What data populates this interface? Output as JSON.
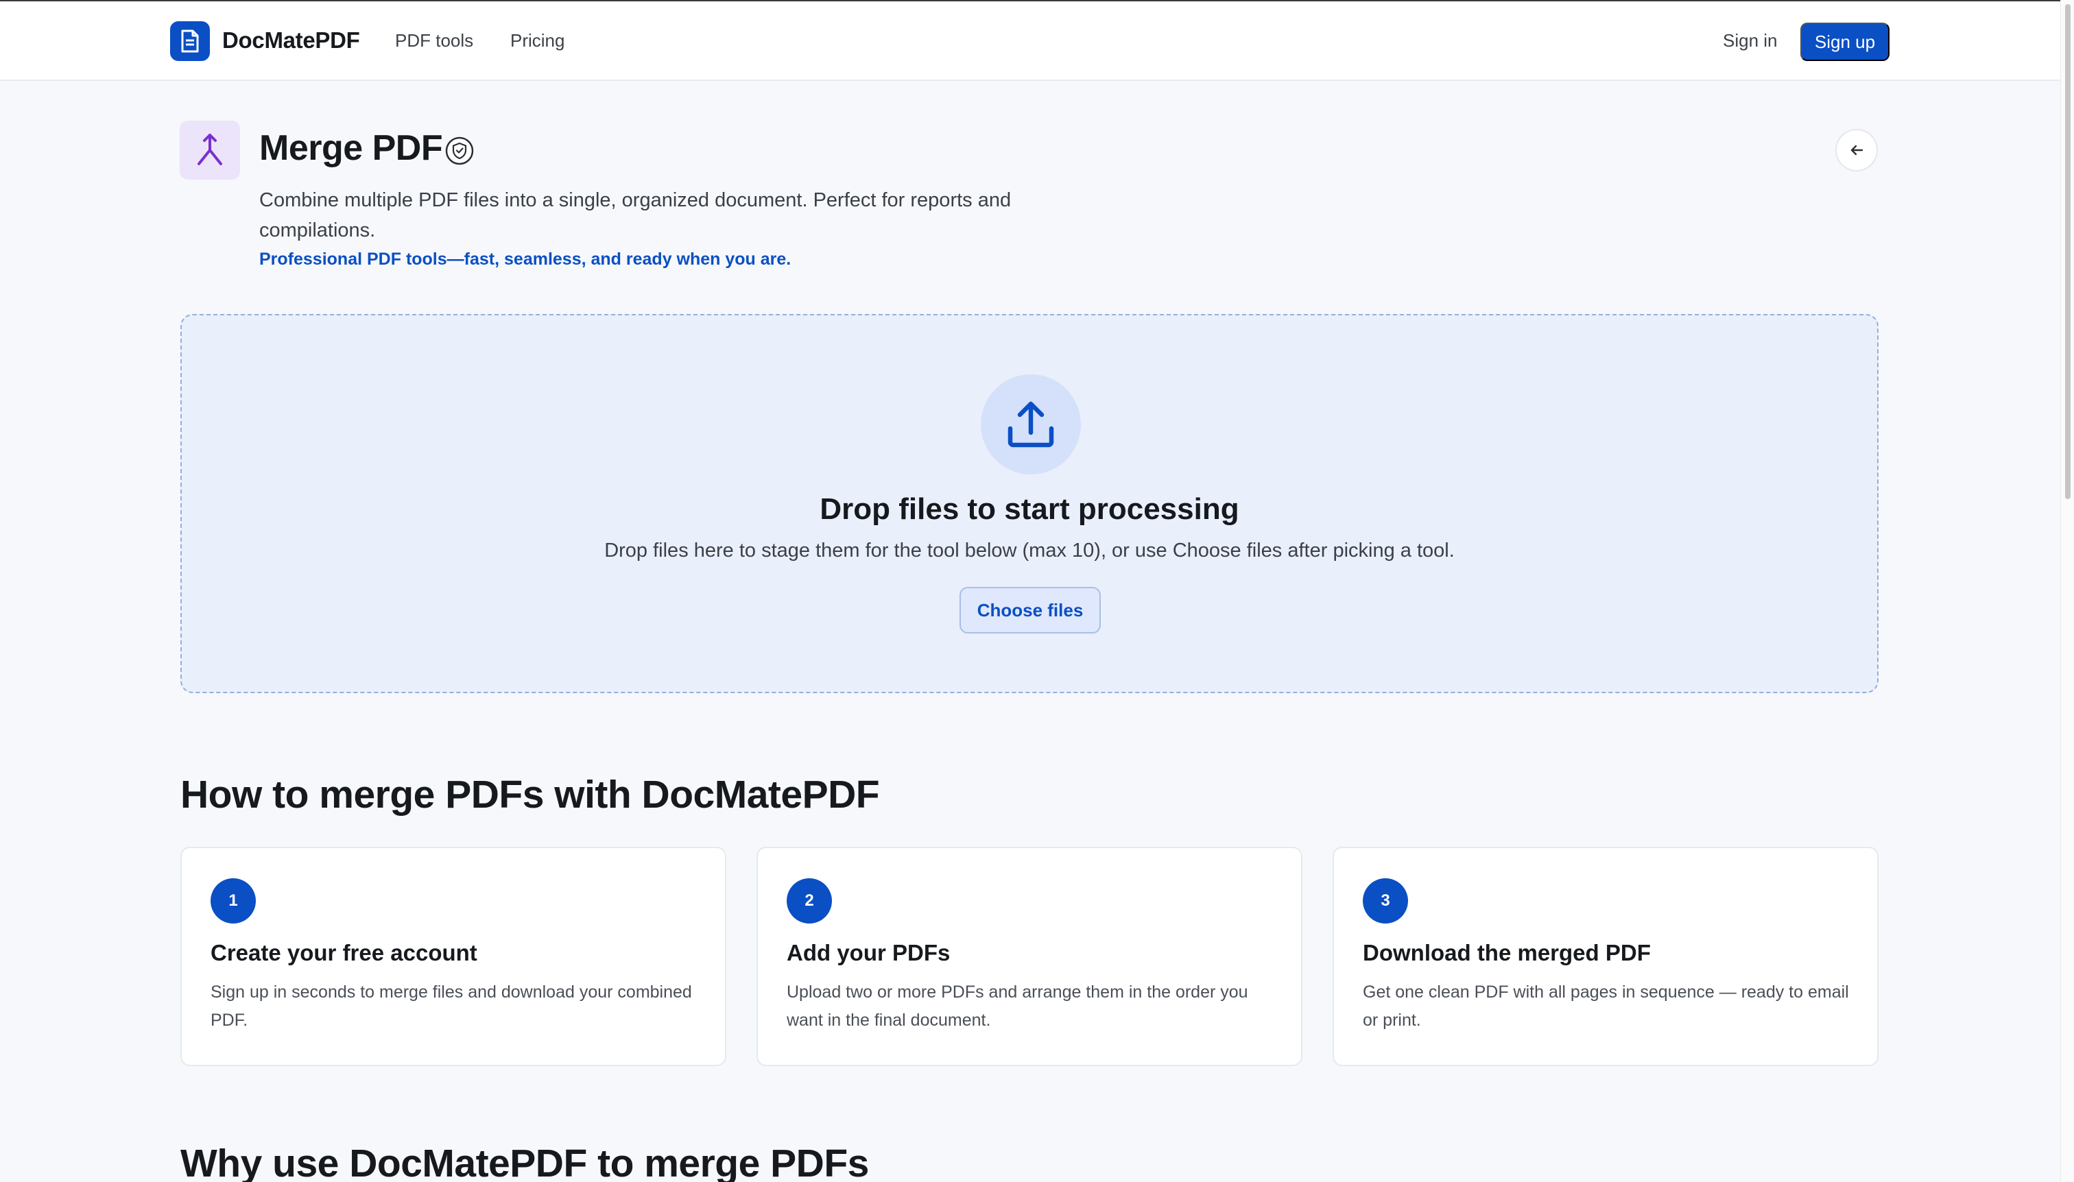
{
  "header": {
    "brand": "DocMatePDF",
    "nav": [
      "PDF tools",
      "Pricing"
    ],
    "sign_in": "Sign in",
    "sign_up": "Sign up"
  },
  "tool": {
    "title": "Merge PDF",
    "description": "Combine multiple PDF files into a single, organized document. Perfect for reports and compilations.",
    "tagline": "Professional PDF tools—fast, seamless, and ready when you are."
  },
  "dropzone": {
    "title": "Drop files to start processing",
    "subtitle": "Drop files here to stage them for the tool below (max 10), or use Choose files after picking a tool.",
    "button": "Choose files"
  },
  "how_to": {
    "title": "How to merge PDFs with DocMatePDF",
    "steps": [
      {
        "number": "1",
        "title": "Create your free account",
        "description": "Sign up in seconds to merge files and download your combined PDF."
      },
      {
        "number": "2",
        "title": "Add your PDFs",
        "description": "Upload two or more PDFs and arrange them in the order you want in the final document."
      },
      {
        "number": "3",
        "title": "Download the merged PDF",
        "description": "Get one clean PDF with all pages in sequence — ready to email or print."
      }
    ]
  },
  "why": {
    "title": "Why use DocMatePDF to merge PDFs"
  },
  "icons": {
    "logo": "document-icon",
    "tool": "merge-icon",
    "verified": "shield-check-icon",
    "back": "arrow-left-icon",
    "upload": "upload-icon"
  },
  "colors": {
    "brand": "#0b4fc4",
    "tool_icon_bg": "#ebe4fb",
    "merge_icon": "#7b2fd0",
    "dropzone_bg": "#eaeffc",
    "page_bg": "#f6f8fb"
  }
}
